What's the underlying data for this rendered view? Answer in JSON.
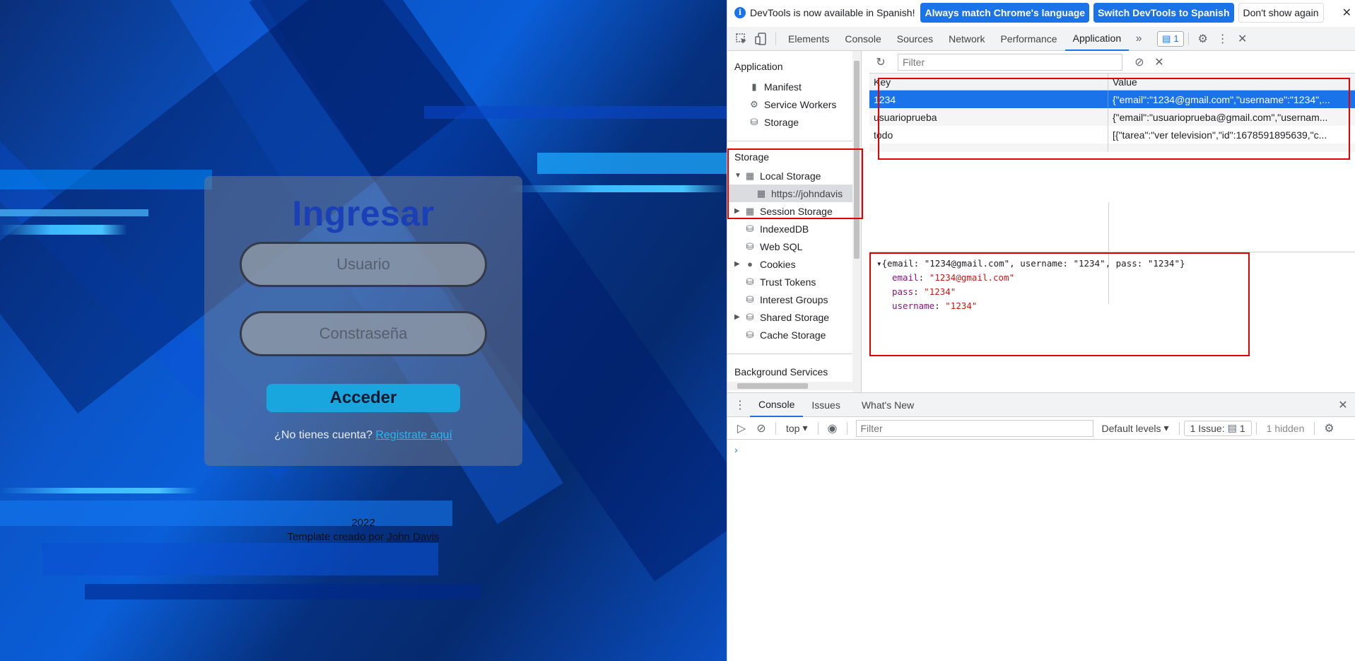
{
  "login": {
    "title": "Ingresar",
    "user_placeholder": "Usuario",
    "pass_placeholder": "Constraseña",
    "submit_label": "Acceder",
    "signup_prompt": "¿No tienes cuenta?",
    "signup_link": "Registrate aquí",
    "footer_year": "2022",
    "footer_text": "Template creado por",
    "footer_author": "John Davis"
  },
  "devtools": {
    "infobar": {
      "text": "DevTools is now available in Spanish!",
      "btn_match": "Always match Chrome's language",
      "btn_switch": "Switch DevTools to Spanish",
      "btn_dismiss": "Don't show again"
    },
    "tabs": [
      "Elements",
      "Console",
      "Sources",
      "Network",
      "Performance",
      "Application"
    ],
    "active_tab": "Application",
    "issues_count": "1",
    "sidebar": {
      "application_title": "Application",
      "application_items": [
        "Manifest",
        "Service Workers",
        "Storage"
      ],
      "storage_title": "Storage",
      "local_storage": "Local Storage",
      "local_origin": "https://johndavis",
      "session_storage": "Session Storage",
      "indexeddb": "IndexedDB",
      "websql": "Web SQL",
      "cookies": "Cookies",
      "trust_tokens": "Trust Tokens",
      "interest_groups": "Interest Groups",
      "shared_storage": "Shared Storage",
      "cache_storage": "Cache Storage",
      "background_title": "Background Services"
    },
    "filter_placeholder": "Filter",
    "table": {
      "key_header": "Key",
      "value_header": "Value",
      "rows": [
        {
          "key": "1234",
          "value": "{\"email\":\"1234@gmail.com\",\"username\":\"1234\",..."
        },
        {
          "key": "usuarioprueba",
          "value": "{\"email\":\"usuarioprueba@gmail.com\",\"usernam..."
        },
        {
          "key": "todo",
          "value": "[{\"tarea\":\"ver television\",\"id\":1678591895639,\"c..."
        }
      ]
    },
    "preview": {
      "summary": "{email: \"1234@gmail.com\", username: \"1234\", pass: \"1234\"}",
      "fields": [
        {
          "key": "email",
          "value": "\"1234@gmail.com\""
        },
        {
          "key": "pass",
          "value": "\"1234\""
        },
        {
          "key": "username",
          "value": "\"1234\""
        }
      ]
    },
    "drawer": {
      "tabs": [
        "Console",
        "Issues",
        "What's New"
      ],
      "context": "top",
      "filter_placeholder": "Filter",
      "levels": "Default levels",
      "issues_label": "1 Issue:",
      "issues_count": "1",
      "hidden": "1 hidden"
    }
  }
}
